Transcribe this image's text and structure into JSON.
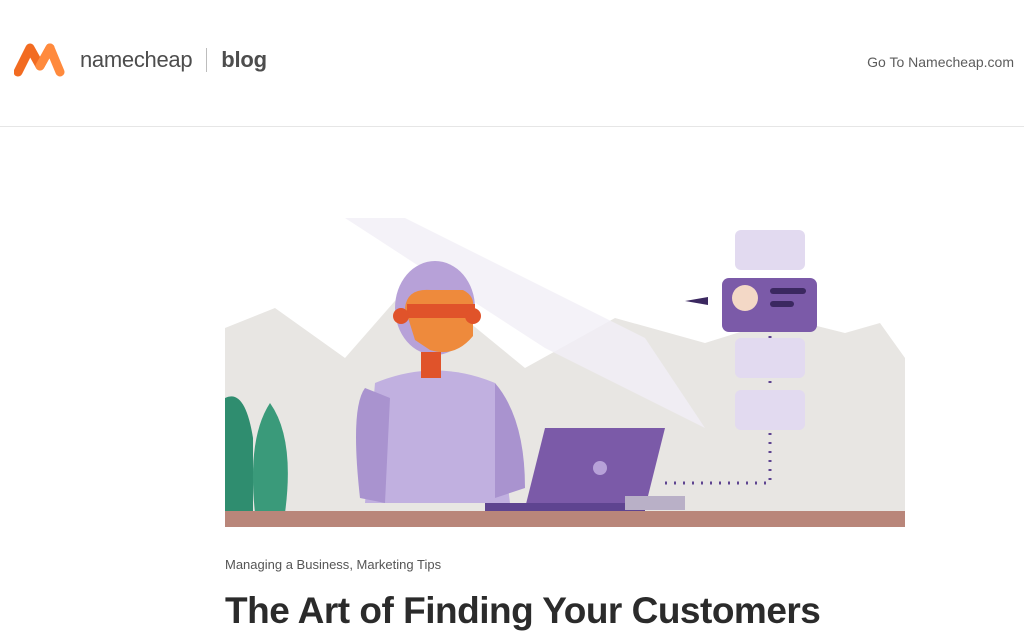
{
  "header": {
    "brand_name": "namecheap",
    "section_label": "blog",
    "external_link": "Go To Namecheap.com"
  },
  "post": {
    "categories": [
      "Managing a Business",
      "Marketing Tips"
    ],
    "category_separator": ", ",
    "title": "The Art of Finding Your Customers"
  },
  "colors": {
    "brand_orange": "#ff5a1f",
    "robot_purple": "#b7a1d8",
    "laptop_purple": "#7b5aa8",
    "desk_brown": "#b9867a",
    "leaf_green": "#3a9a7a"
  },
  "icons": {
    "logo": "namecheap-n-logo",
    "hero": "robot-laptop-illustration"
  }
}
